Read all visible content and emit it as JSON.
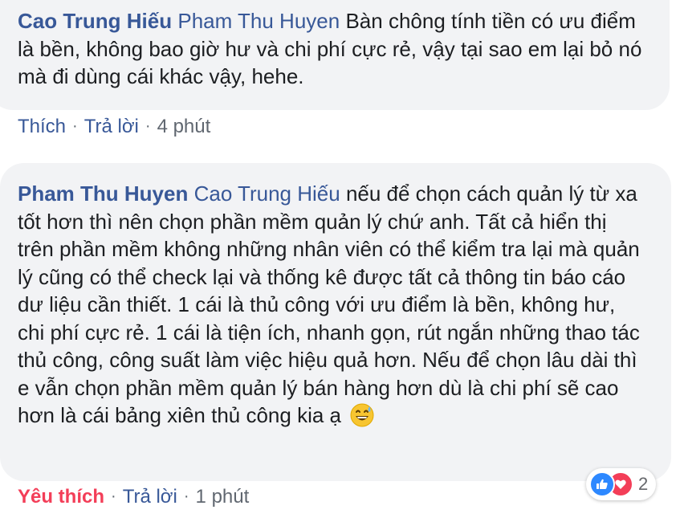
{
  "comments": [
    {
      "author": "Cao Trung Hiếu",
      "mention": "Pham Thu Huyen",
      "text": "Bàn chông tính tiền có ưu điểm là bền, không bao giờ hư và chi phí cực rẻ, vậy tại sao em lại bỏ nó mà đi dùng cái khác vậy, hehe.",
      "actions": {
        "like": "Thích",
        "reply": "Trả lời",
        "time": "4 phút"
      }
    },
    {
      "author": "Pham Thu Huyen",
      "mention": "Cao Trung Hiếu",
      "text": "nếu để chọn cách quản lý từ xa tốt hơn thì nên chọn phần mềm quản lý chứ anh. Tất cả hiển thị trên phần mềm không những nhân viên có thể kiểm tra lại mà quản lý cũng có thể check lại và thống kê được tất cả thông tin báo cáo dư liệu cần thiết. 1 cái là thủ công với ưu điểm là bền, không hư, chi phí cực rẻ. 1 cái là tiện ích, nhanh gọn, rút ngắn những thao tác thủ công, công suất làm việc hiệu quả hơn. Nếu để chọn lâu dài thì e vẫn chọn phần mềm quản lý bán hàng hơn dù là chi phí sẽ cao hơn là cái bảng xiên thủ công kia ạ",
      "emoji": "grinning-sweat-emoji",
      "actions": {
        "like": "Yêu thích",
        "reply": "Trả lời",
        "time": "1 phút"
      },
      "reactions": {
        "icons": [
          "like-icon",
          "love-icon"
        ],
        "count": "2"
      }
    }
  ],
  "separator": "·",
  "colors": {
    "name": "#385898",
    "bubble": "#f2f3f5",
    "text": "#1c1e21",
    "meta": "#606770",
    "love": "#f33e58",
    "like": "#2d88ff"
  }
}
